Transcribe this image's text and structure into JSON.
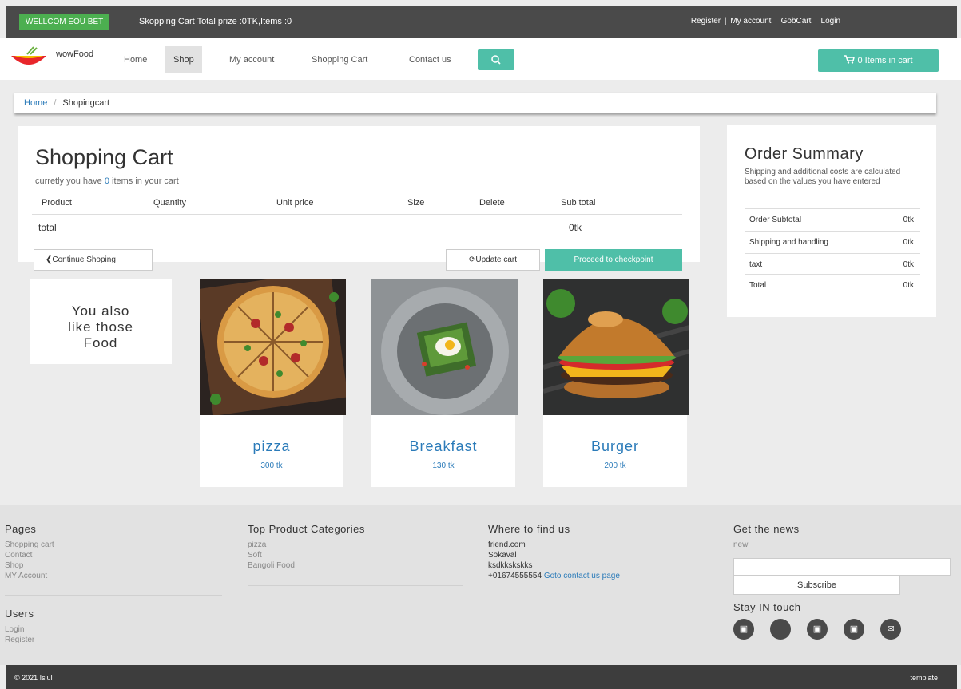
{
  "topbar": {
    "welcome": "WELLCOM EOU BET",
    "cart_info": "Skopping Cart Total prize :0TK,Items :0",
    "links": [
      "Register",
      "My account",
      "GobCart",
      "Login"
    ]
  },
  "nav": {
    "logo_text": "wowFood",
    "items": [
      "Home",
      "Shop",
      "My account",
      "Shopping Cart",
      "Contact us"
    ],
    "cart_button": "0 Items in cart"
  },
  "breadcrumb": {
    "home": "Home",
    "current": "Shopingcart"
  },
  "cart": {
    "title": "Shopping Cart",
    "subtitle_pre": "curretly you have",
    "count": "0",
    "subtitle_post": "items in your cart",
    "columns": [
      "Product",
      "Quantity",
      "Unit price",
      "Size",
      "Delete",
      "Sub total"
    ],
    "total_label": "total",
    "total_value": "0tk",
    "continue": "Continue Shoping",
    "update": "Update cart",
    "proceed": "Proceed to checkpoint"
  },
  "summary": {
    "title": "Order Summary",
    "note": "Shipping and additional costs are calculated based on the values you have entered",
    "rows": [
      {
        "label": "Order Subtotal",
        "value": "0tk"
      },
      {
        "label": "Shipping and handling",
        "value": "0tk"
      },
      {
        "label": "taxt",
        "value": "0tk"
      },
      {
        "label": "Total",
        "value": "0tk"
      }
    ]
  },
  "also": {
    "line1": "You also",
    "line2": "like those",
    "line3": "Food"
  },
  "products": [
    {
      "name": "pizza",
      "price": "300 tk"
    },
    {
      "name": "Breakfast",
      "price": "130 tk"
    },
    {
      "name": "Burger",
      "price": "200 tk"
    }
  ],
  "footer": {
    "pages_title": "Pages",
    "pages": [
      "Shopping cart",
      "Contact",
      "Shop",
      "MY Account"
    ],
    "users_title": "Users",
    "users": [
      "Login",
      "Register"
    ],
    "categories_title": "Top Product Categories",
    "categories": [
      "pizza",
      "Soft",
      "Bangoli Food"
    ],
    "where_title": "Where to find us",
    "address": [
      "friend.com",
      "Sokaval",
      "ksdkkskskks"
    ],
    "phone": "+01674555554",
    "contact_link": "Goto contact us page",
    "news_title": "Get the news",
    "news_sub": "new",
    "subscribe": "Subscribe",
    "stay_title": "Stay IN touch"
  },
  "bottom": {
    "copyright": "© 2021 Isiul",
    "template": "template"
  }
}
